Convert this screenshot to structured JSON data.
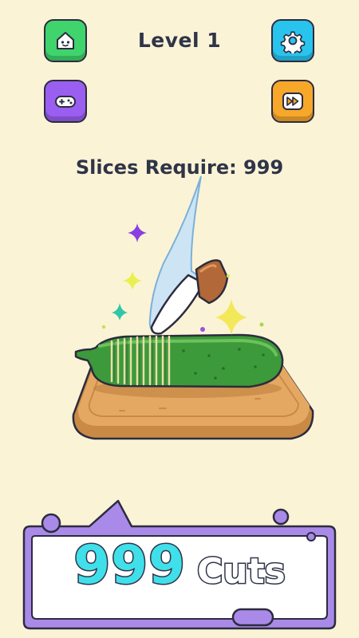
{
  "header": {
    "level_label": "Level 1"
  },
  "buttons": {
    "home_icon": "home-icon",
    "settings_icon": "gear-icon",
    "games_icon": "gamepad-icon",
    "skip_icon": "fast-forward-icon"
  },
  "game": {
    "slices_require": "Slices Require: 999",
    "item": "cucumber"
  },
  "cuts": {
    "number": "999",
    "word": "Cuts"
  },
  "colors": {
    "background": "#fbf3d6",
    "home_button": "#3fd46c",
    "settings_button": "#29c4ee",
    "games_button": "#9a5ef0",
    "skip_button": "#f7a72a",
    "cuts_number": "#40e0ea",
    "panel_accent": "#a98ae8"
  }
}
